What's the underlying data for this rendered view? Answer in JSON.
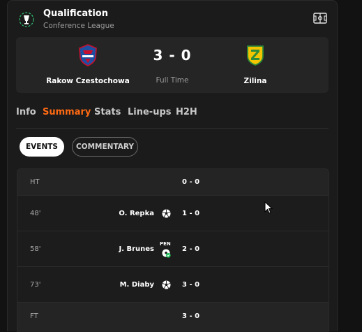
{
  "header": {
    "title": "Qualification",
    "subtitle": "Conference League",
    "competition_icon": "conference-league-logo",
    "pitch_icon": "pitch-icon"
  },
  "match": {
    "home": {
      "name": "Rakow Czestochowa",
      "crest": "rakow-crest"
    },
    "away": {
      "name": "Zilina",
      "crest": "zilina-crest"
    },
    "score": "3 - 0",
    "status": "Full Time"
  },
  "tabs": [
    {
      "label": "Info",
      "active": false
    },
    {
      "label": "Summary",
      "active": true
    },
    {
      "label": "Stats",
      "active": false
    },
    {
      "label": "Line-ups",
      "active": false
    },
    {
      "label": "H2H",
      "active": false
    }
  ],
  "toggles": {
    "events": "EVENTS",
    "commentary": "COMMENTARY",
    "selected": "events"
  },
  "events": [
    {
      "minute": "HT",
      "player": "",
      "icon": "",
      "pen": "",
      "score": "0 - 0"
    },
    {
      "minute": "48'",
      "player": "O. Repka",
      "icon": "goal-ball-icon",
      "pen": "",
      "score": "1 - 0"
    },
    {
      "minute": "58'",
      "player": "J. Brunes",
      "icon": "penalty-goal-icon",
      "pen": "PEN",
      "score": "2 - 0"
    },
    {
      "minute": "73'",
      "player": "M. Diaby",
      "icon": "goal-ball-icon",
      "pen": "",
      "score": "3 - 0"
    },
    {
      "minute": "FT",
      "player": "",
      "icon": "",
      "pen": "",
      "score": "3 - 0"
    }
  ],
  "colors": {
    "accent": "#ff6a13",
    "background": "#121212",
    "panel": "#1b1b1b",
    "card": "#252525",
    "penalty_check": "#22c55e"
  }
}
